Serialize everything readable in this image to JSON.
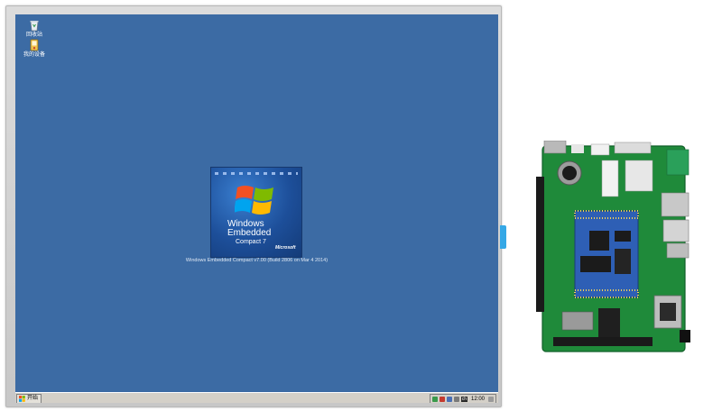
{
  "desktop": {
    "icons": [
      {
        "label": "回收站",
        "icon": "recycle-bin-icon"
      },
      {
        "label": "我的设备",
        "icon": "my-device-icon"
      }
    ]
  },
  "splash": {
    "brand_line1": "Windows",
    "brand_line2": "Embedded",
    "brand_line3": "Compact 7",
    "vendor": "Microsoft",
    "build_text": "Windows Embedded Compact v7.00 (Build 2806 on Mar  4 2014)"
  },
  "taskbar": {
    "start_label": "开始",
    "clock": "12:00",
    "tray_badge": "ch"
  },
  "colors": {
    "desktop_bg": "#3c6ba4",
    "taskbar_bg": "#d4d0c8",
    "side_tab": "#35a8e6",
    "pcb_green": "#1f8a3a"
  }
}
